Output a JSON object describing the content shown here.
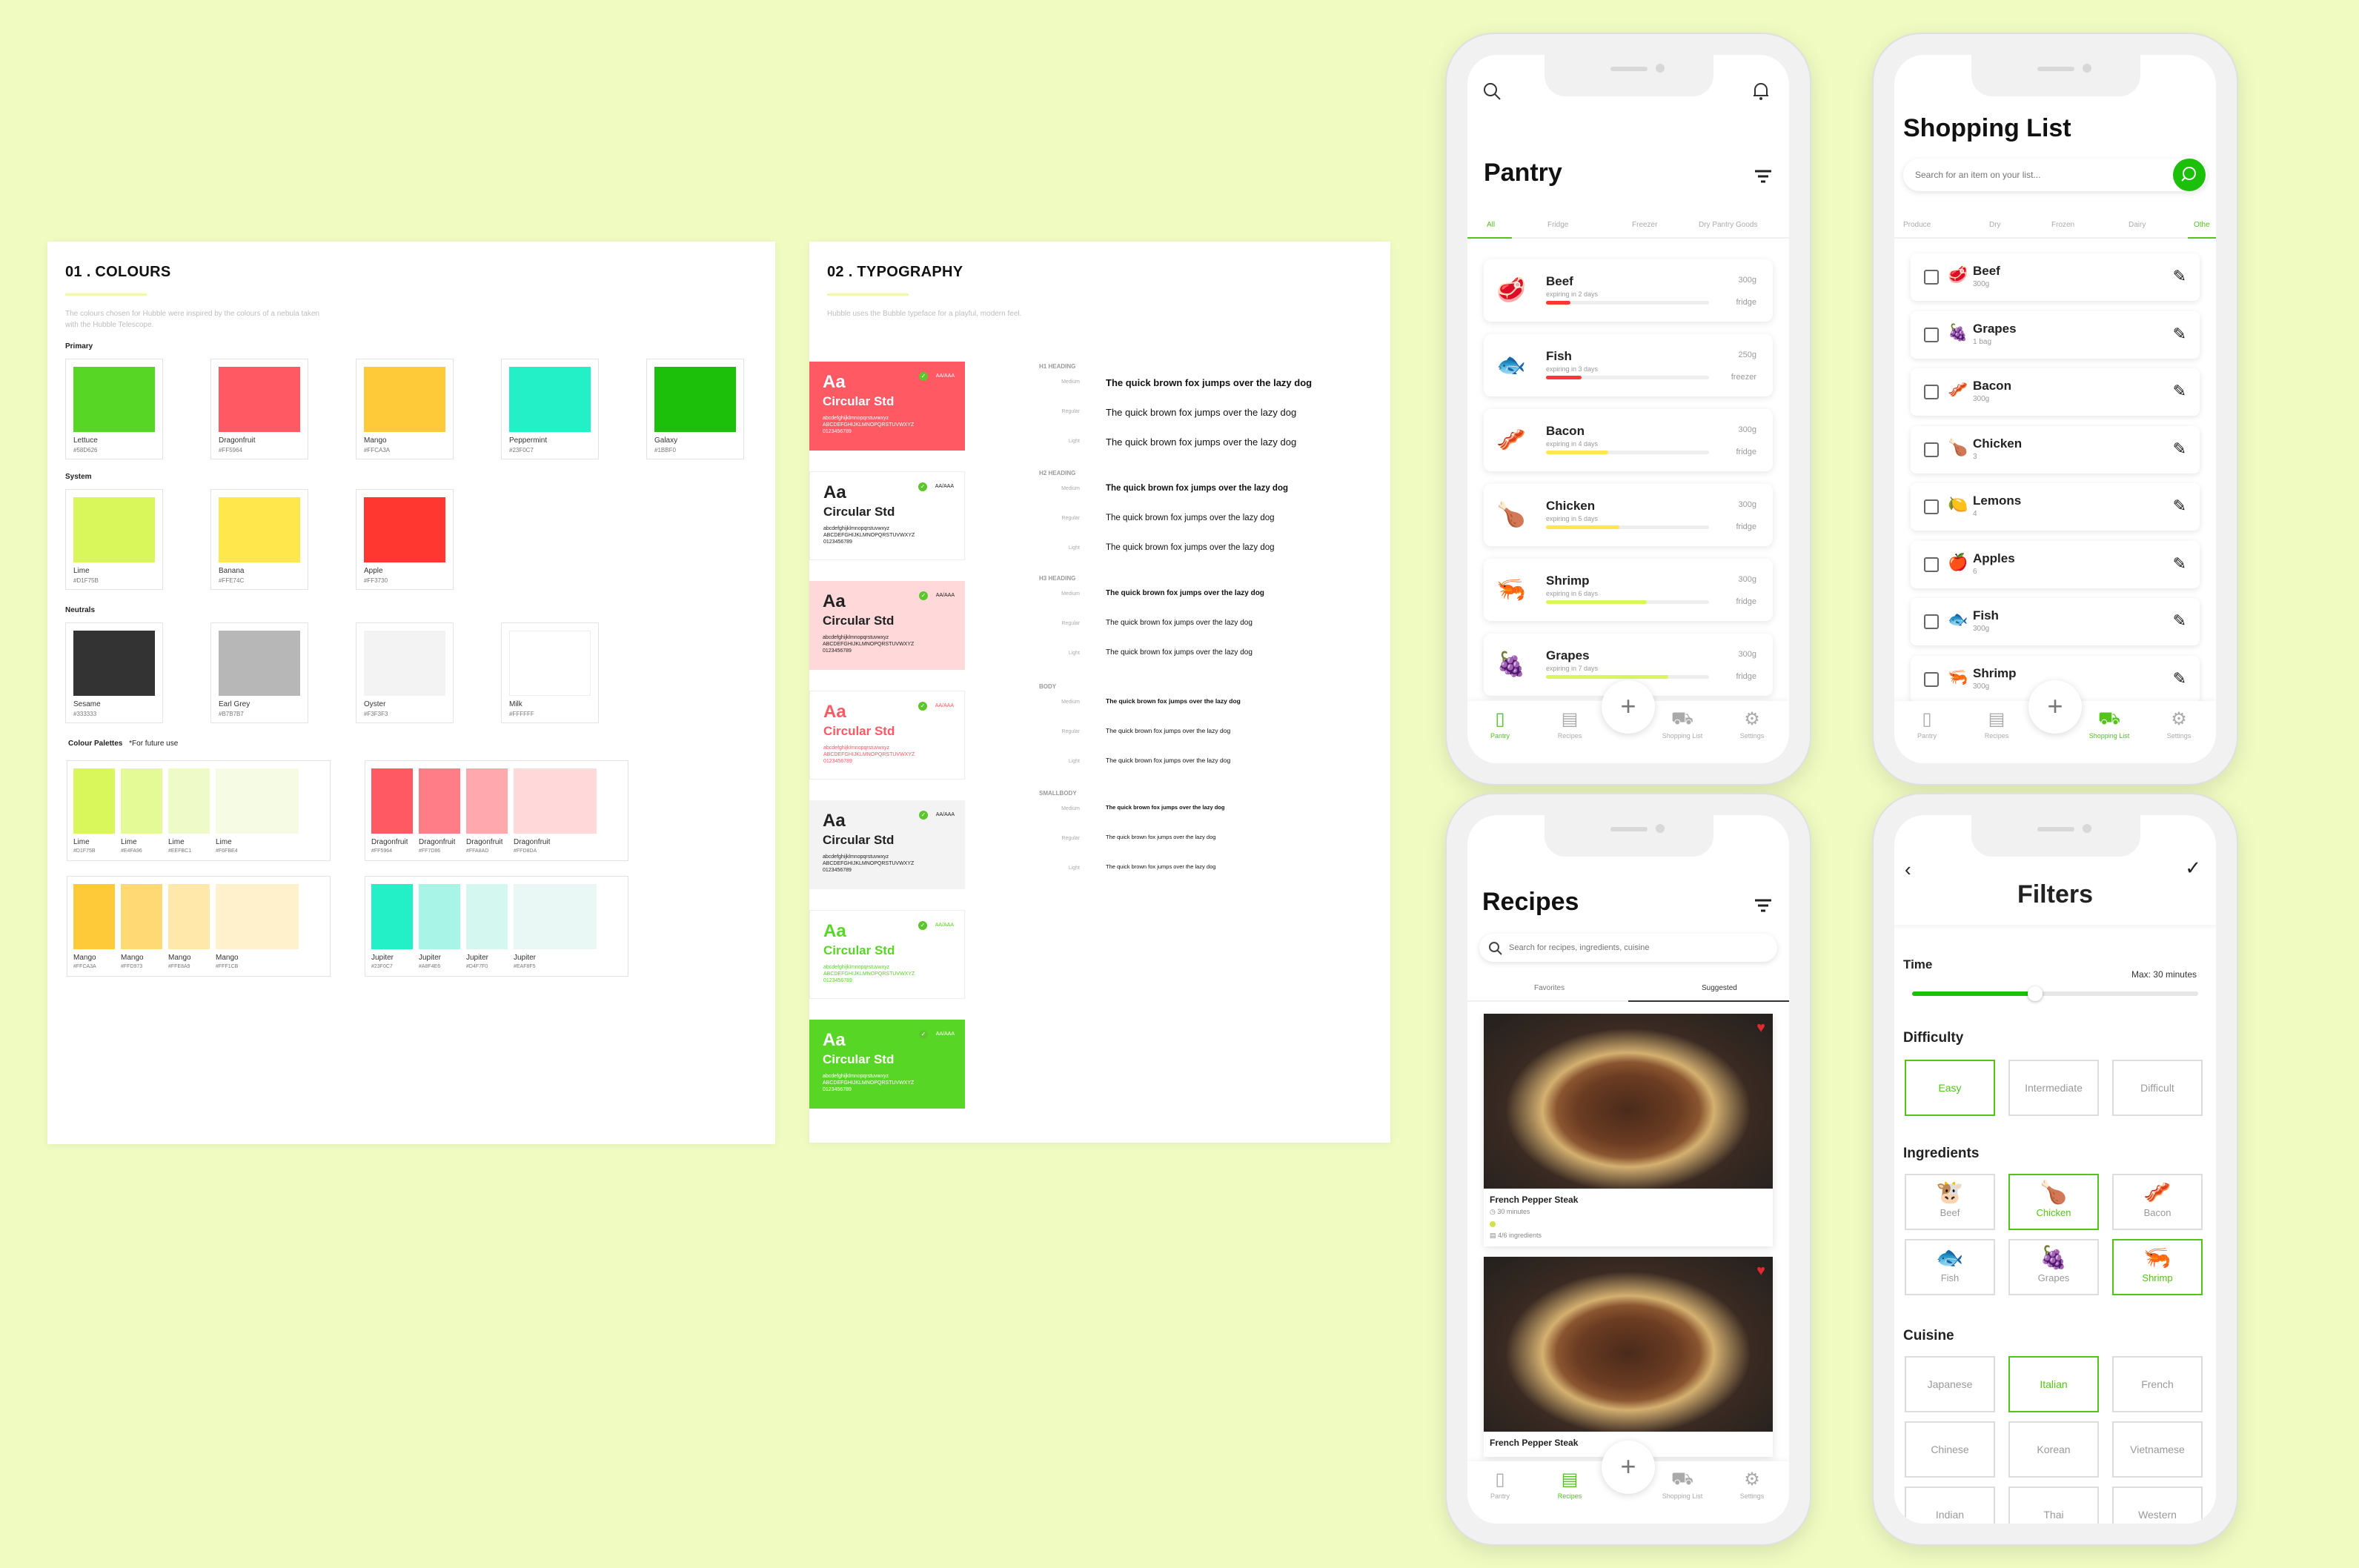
{
  "colours": {
    "title": "01 . COLOURS",
    "desc": "The colours chosen for Hubble were inspired by the colours of a nebula taken with the Hubble Telescope.",
    "primary_label": "Primary",
    "system_label": "System",
    "neutrals_label": "Neutrals",
    "palettes_label": "Colour Palettes",
    "palettes_note": "*For future use",
    "primary": [
      {
        "name": "Lettuce",
        "hex": "#58D626",
        "color": "#58D626"
      },
      {
        "name": "Dragonfruit",
        "hex": "#FF5964",
        "color": "#FF5964"
      },
      {
        "name": "Mango",
        "hex": "#FFCA3A",
        "color": "#FFCA3A"
      },
      {
        "name": "Peppermint",
        "hex": "#23F0C7",
        "color": "#23F0C7"
      },
      {
        "name": "Galaxy",
        "hex": "#1BBF0",
        "color": "#1CBF0A"
      }
    ],
    "system": [
      {
        "name": "Lime",
        "hex": "#D1F75B",
        "color": "#D9F75B"
      },
      {
        "name": "Banana",
        "hex": "#FFE74C",
        "color": "#FFE74C"
      },
      {
        "name": "Apple",
        "hex": "#FF3730",
        "color": "#FF3730"
      }
    ],
    "neutrals": [
      {
        "name": "Sesame",
        "hex": "#333333",
        "color": "#333333"
      },
      {
        "name": "Earl Grey",
        "hex": "#B7B7B7",
        "color": "#B7B7B7"
      },
      {
        "name": "Oyster",
        "hex": "#F3F3F3",
        "color": "#F3F3F3"
      },
      {
        "name": "Milk",
        "hex": "#FFFFFF",
        "color": "#FFFFFF"
      }
    ],
    "palettes": [
      [
        {
          "name": "Lime",
          "hex": "#D1F75B",
          "color": "#D9F75B"
        },
        {
          "name": "Lime",
          "hex": "#E4FA96",
          "color": "#E4FA96"
        },
        {
          "name": "Lime",
          "hex": "#EEFBC1",
          "color": "#EEFBC9"
        },
        {
          "name": "Lime",
          "hex": "#F6FBE4",
          "color": "#F6FBE4"
        }
      ],
      [
        {
          "name": "Dragonfruit",
          "hex": "#FF5964",
          "color": "#FF5964"
        },
        {
          "name": "Dragonfruit",
          "hex": "#FF7D86",
          "color": "#FF7D86"
        },
        {
          "name": "Dragonfruit",
          "hex": "#FFA8AD",
          "color": "#FFA8AD"
        },
        {
          "name": "Dragonfruit",
          "hex": "#FFD8DA",
          "color": "#FFD8DA"
        }
      ],
      [
        {
          "name": "Mango",
          "hex": "#FFCA3A",
          "color": "#FFCA3A"
        },
        {
          "name": "Mango",
          "hex": "#FFD973",
          "color": "#FFD973"
        },
        {
          "name": "Mango",
          "hex": "#FFE8A9",
          "color": "#FFE8A9"
        },
        {
          "name": "Mango",
          "hex": "#FFF1CB",
          "color": "#FFF1CB"
        }
      ],
      [
        {
          "name": "Jupiter",
          "hex": "#23F0C7",
          "color": "#23F0C7"
        },
        {
          "name": "Jupiter",
          "hex": "#A8F4E6",
          "color": "#A8F4E6"
        },
        {
          "name": "Jupiter",
          "hex": "#D4F7F0",
          "color": "#D4F7F0"
        },
        {
          "name": "Jupiter",
          "hex": "#EAF8F5",
          "color": "#EAF8F5"
        }
      ]
    ]
  },
  "typography": {
    "title": "02 . TYPOGRAPHY",
    "desc": "Hubble uses the Bubble typeface for a playful, modern feel.",
    "samples": [
      {
        "aa": "Aa",
        "font": "Circular Std",
        "bg": "#FF5964",
        "fg": "#FFFFFF",
        "badge": "AA/AAA"
      },
      {
        "aa": "Aa",
        "font": "Circular Std",
        "bg": "#FFFFFF",
        "fg": "#222222",
        "badge": "AA/AAA"
      },
      {
        "aa": "Aa",
        "font": "Circular Std",
        "bg": "#FFD8DA",
        "fg": "#222222",
        "badge": "AA/AAA"
      },
      {
        "aa": "Aa",
        "font": "Circular Std",
        "bg": "#FFFFFF",
        "fg": "#FF5964",
        "badge": "AA/AAA"
      },
      {
        "aa": "Aa",
        "font": "Circular Std",
        "bg": "#F3F3F3",
        "fg": "#222222",
        "badge": "AA/AAA"
      },
      {
        "aa": "Aa",
        "font": "Circular Std",
        "bg": "#FFFFFF",
        "fg": "#58D626",
        "badge": "AA/AAA"
      },
      {
        "aa": "Aa",
        "font": "Circular Std",
        "bg": "#58D626",
        "fg": "#FFFFFF",
        "badge": "AA/AAA"
      }
    ],
    "lower": "abcdefghijklmnopqrstuvwxyz",
    "upper": "ABCDEFGHIJKLMNOPQRSTUVWXYZ",
    "digits": "0123456789",
    "headings": [
      "H1 HEADING",
      "H2 HEADING",
      "H3 HEADING",
      "BODY",
      "SMALLBODY"
    ],
    "weights": [
      "Medium",
      "Regular",
      "Light"
    ],
    "pangram": "The quick brown fox jumps over the lazy dog"
  },
  "pantry": {
    "title": "Pantry",
    "tabs": [
      "All",
      "Fridge",
      "Freezer",
      "Dry Pantry Goods"
    ],
    "items": [
      {
        "name": "Beef",
        "expiry": "expiring in 2 days",
        "qty": "300g",
        "loc": "fridge",
        "icon": "🥩",
        "level": 0.15,
        "color": "#FF3730"
      },
      {
        "name": "Fish",
        "expiry": "expiring in 3 days",
        "qty": "250g",
        "loc": "freezer",
        "icon": "🐟",
        "level": 0.22,
        "color": "#FF3730"
      },
      {
        "name": "Bacon",
        "expiry": "expiring in 4 days",
        "qty": "300g",
        "loc": "fridge",
        "icon": "🥓",
        "level": 0.38,
        "color": "#FFE74C"
      },
      {
        "name": "Chicken",
        "expiry": "expiring in 5 days",
        "qty": "300g",
        "loc": "fridge",
        "icon": "🍗",
        "level": 0.45,
        "color": "#FFE74C"
      },
      {
        "name": "Shrimp",
        "expiry": "expiring in 6 days",
        "qty": "300g",
        "loc": "fridge",
        "icon": "🦐",
        "level": 0.62,
        "color": "#D9F75B"
      },
      {
        "name": "Grapes",
        "expiry": "expiring in 7 days",
        "qty": "300g",
        "loc": "fridge",
        "icon": "🍇",
        "level": 0.75,
        "color": "#D9F75B"
      }
    ]
  },
  "nav": {
    "pantry": "Pantry",
    "recipes": "Recipes",
    "shopping": "Shopping List",
    "settings": "Settings"
  },
  "shopping": {
    "title": "Shopping List",
    "search_placeholder": "Search for an item on your list...",
    "tabs": [
      "Produce",
      "Dry",
      "Frozen",
      "Dairy",
      "Othe"
    ],
    "items": [
      {
        "name": "Beef",
        "qty": "300g",
        "icon": "🥩"
      },
      {
        "name": "Grapes",
        "qty": "1 bag",
        "icon": "🍇"
      },
      {
        "name": "Bacon",
        "qty": "300g",
        "icon": "🥓"
      },
      {
        "name": "Chicken",
        "qty": "3",
        "icon": "🍗"
      },
      {
        "name": "Lemons",
        "qty": "4",
        "icon": "🍋"
      },
      {
        "name": "Apples",
        "qty": "6",
        "icon": "🍎"
      },
      {
        "name": "Fish",
        "qty": "300g",
        "icon": "🐟"
      },
      {
        "name": "Shrimp",
        "qty": "300g",
        "icon": "🦐"
      }
    ]
  },
  "recipes": {
    "title": "Recipes",
    "search_placeholder": "Search for recipes, ingredients, cuisine",
    "tabs": [
      "Favorites",
      "Suggested"
    ],
    "cards": [
      {
        "name": "French Pepper Steak",
        "time": "30 minutes",
        "ingredients": "4/6 ingredients"
      },
      {
        "name": "French Pepper Steak"
      }
    ]
  },
  "filters": {
    "title": "Filters",
    "time_label": "Time",
    "time_max": "Max: 30 minutes",
    "time_level": 0.43,
    "difficulty_label": "Difficulty",
    "difficulty": [
      "Easy",
      "Intermediate",
      "Difficult"
    ],
    "ingredients_label": "Ingredients",
    "ingredients": [
      {
        "name": "Beef",
        "icon": "🐮",
        "sel": false
      },
      {
        "name": "Chicken",
        "icon": "🍗",
        "sel": true
      },
      {
        "name": "Bacon",
        "icon": "🥓",
        "sel": false
      },
      {
        "name": "Fish",
        "icon": "🐟",
        "sel": false
      },
      {
        "name": "Grapes",
        "icon": "🍇",
        "sel": false
      },
      {
        "name": "Shrimp",
        "icon": "🦐",
        "sel": true
      }
    ],
    "cuisine_label": "Cuisine",
    "cuisine": [
      "Japanese",
      "Italian",
      "French",
      "Chinese",
      "Korean",
      "Vietnamese",
      "Indian",
      "Thai",
      "Western"
    ]
  }
}
